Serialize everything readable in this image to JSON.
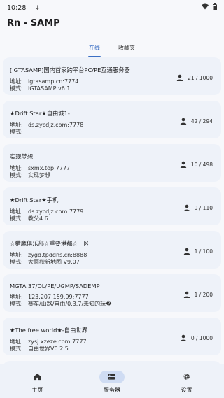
{
  "status_bar": {
    "time": "10:28"
  },
  "app": {
    "title": "Rn - SAMP"
  },
  "tabs": [
    {
      "label": "在线",
      "active": true
    },
    {
      "label": "收藏夹",
      "active": false
    }
  ],
  "labels": {
    "address": "地址:",
    "mode": "模式:"
  },
  "servers": [
    {
      "name": "[IGTASAMP]国内首家跨平台PC/PE互通服务器",
      "address": "igtasamp.cn:7774",
      "mode": "IGTASAMP v6.1",
      "players": "21 / 1000"
    },
    {
      "name": "★Drift Star★自由城1-",
      "address": "ds.zycdjz.com:7778",
      "mode": "",
      "players": "42 / 294"
    },
    {
      "name": "实现梦想",
      "address": "sxmx.top:7777",
      "mode": "实现梦想",
      "players": "10 / 498"
    },
    {
      "name": "★Drift Star★手机",
      "address": "ds.zycdjz.com:7779",
      "mode": "教父4.6",
      "players": "9 / 110"
    },
    {
      "name": "☆猎鹰俱乐部☆重要港都☆一区",
      "address": "zygd.tpddns.cn:8888",
      "mode": "大面积新地图 V9.07",
      "players": "1 / 100"
    },
    {
      "name": "MGTA 37/DL/PE/UGMP/SADEMP",
      "address": "123.207.159.99:7777",
      "mode": "赛车/山路/自由/0.3.7/未知的玩�",
      "players": "1 / 200"
    },
    {
      "name": "★The free world★-自由世界",
      "address": "zysj.xzeze.com:7777",
      "mode": "自由世界V0.2.5",
      "players": "0 / 1000"
    }
  ],
  "bottom_nav": [
    {
      "label": "主页",
      "icon": "home-icon",
      "active": false
    },
    {
      "label": "服务器",
      "icon": "server-icon",
      "active": true
    },
    {
      "label": "设置",
      "icon": "gear-icon",
      "active": false
    }
  ]
}
